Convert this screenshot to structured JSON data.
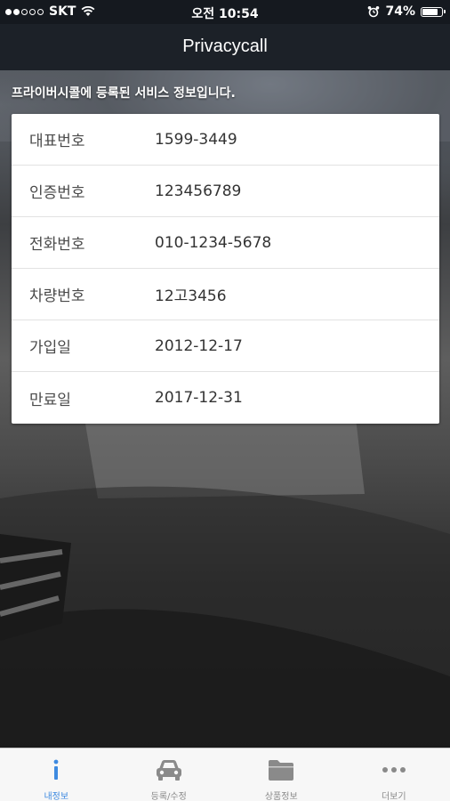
{
  "status_bar": {
    "carrier": "SKT",
    "time": "오전 10:54",
    "battery": "74%",
    "battery_level": 0.74,
    "signal_bars": 2
  },
  "nav": {
    "title": "Privacycall"
  },
  "intro_text": "프라이버시콜에 등록된 서비스 정보입니다.",
  "info_rows": [
    {
      "label": "대표번호",
      "value": "1599-3449"
    },
    {
      "label": "인증번호",
      "value": "123456789"
    },
    {
      "label": "전화번호",
      "value": "010-1234-5678"
    },
    {
      "label": "차량번호",
      "value": "12고3456"
    },
    {
      "label": "가입일",
      "value": "2012-12-17"
    },
    {
      "label": "만료일",
      "value": "2017-12-31"
    }
  ],
  "tabs": [
    {
      "label": "내정보",
      "icon": "info-icon",
      "active": true
    },
    {
      "label": "등록/수정",
      "icon": "car-icon",
      "active": false
    },
    {
      "label": "상품정보",
      "icon": "folder-icon",
      "active": false
    },
    {
      "label": "더보기",
      "icon": "more-icon",
      "active": false
    }
  ],
  "colors": {
    "tab_active": "#3e8ae0",
    "tab_inactive": "#8a8a8a",
    "navbar": "#1c2128"
  }
}
